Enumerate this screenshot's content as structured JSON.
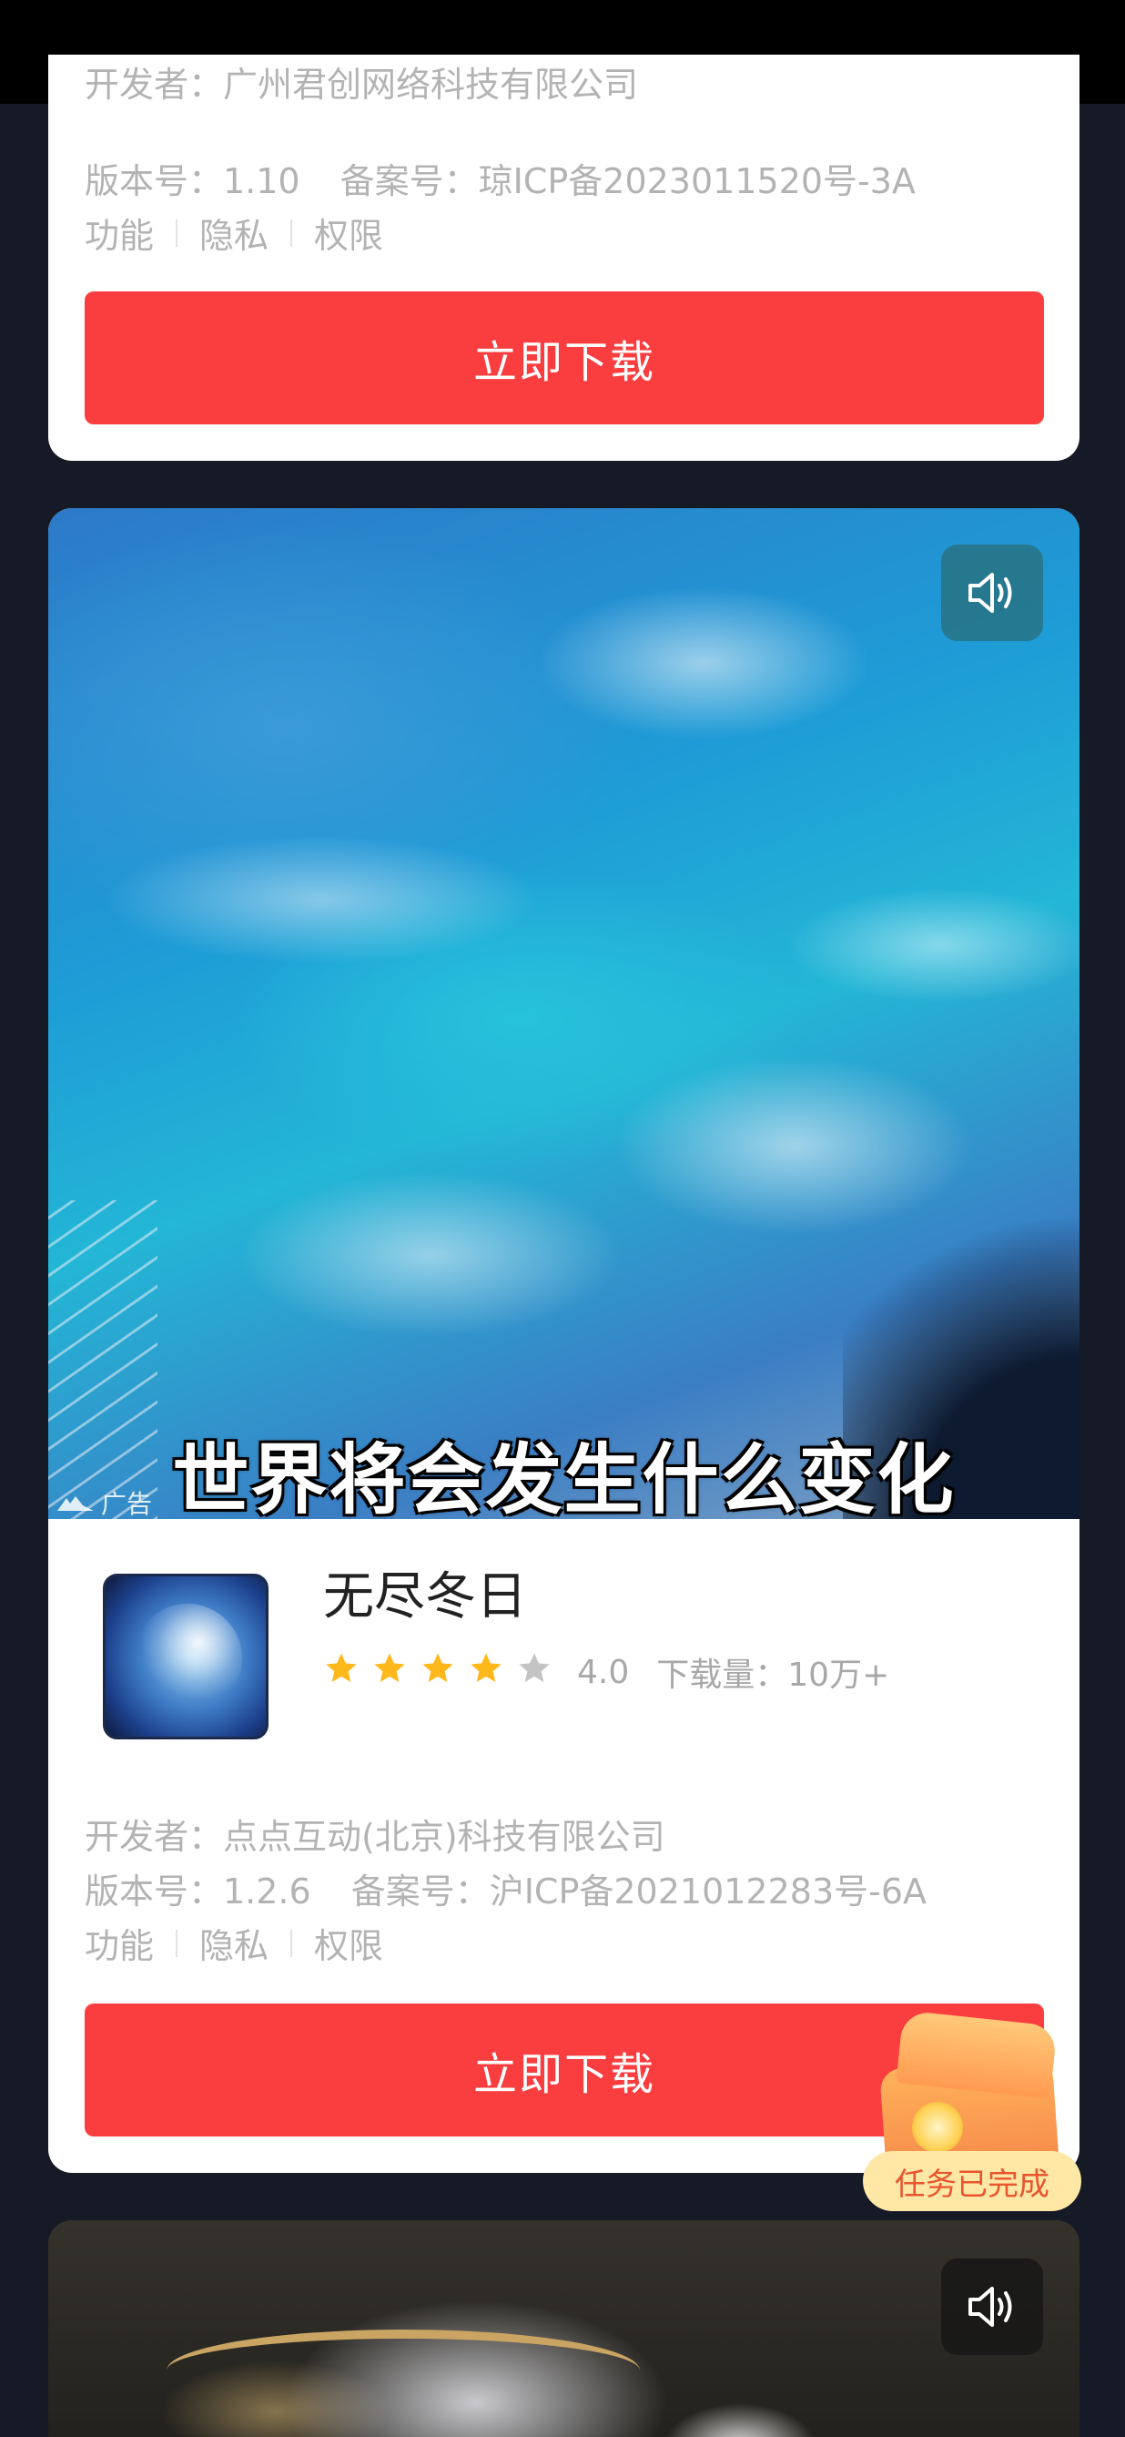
{
  "card1": {
    "developer": "开发者：广州君创网络科技有限公司",
    "version": "版本号：1.10",
    "icp": "备案号：琼ICP备2023011520号-3A",
    "links": [
      "功能",
      "隐私",
      "权限"
    ],
    "download_label": "立即下载"
  },
  "card2": {
    "video_subtitle": "世界将会发生什么变化",
    "ad_label": "广告",
    "app_name": "无尽冬日",
    "rating": 4.0,
    "rating_text": "4.0",
    "stars_filled": 4,
    "stars_total": 5,
    "downloads": "下载量：10万+",
    "developer": "开发者：点点互动(北京)科技有限公司",
    "version": "版本号：1.2.6",
    "icp": "备案号：沪ICP备2021012283号-6A",
    "links": [
      "功能",
      "隐私",
      "权限"
    ],
    "download_label": "立即下载"
  },
  "reward": {
    "status": "任务已完成"
  },
  "colors": {
    "background": "#161a26",
    "download_button": "#fa3d3f",
    "star_filled": "#ffb81c",
    "star_empty": "#c4c4c4",
    "reward_text": "#e8552e"
  },
  "icons": [
    "sound-icon",
    "ad-icon",
    "star-icon",
    "chest-icon"
  ]
}
